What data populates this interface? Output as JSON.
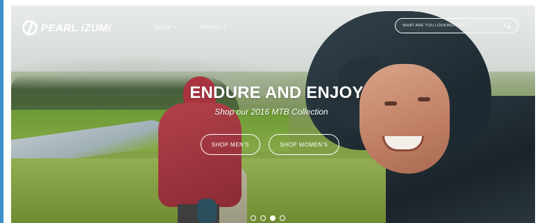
{
  "brand": {
    "name": "PEARL iZUMi",
    "logo_icon": "pearl-izumi-logo-mark"
  },
  "nav": {
    "items": [
      {
        "label": "SHOP",
        "icon": "chevron-down-icon"
      },
      {
        "label": "BRAND",
        "icon": "chevron-down-icon"
      }
    ]
  },
  "search": {
    "placeholder": "WHAT ARE YOU LOOKING FOR?",
    "icon": "search-icon"
  },
  "hero": {
    "headline": "ENDURE AND ENJOY",
    "subhead": "Shop our 2016 MTB Collection",
    "buttons": [
      {
        "label": "SHOP MEN'S"
      },
      {
        "label": "SHOP WOMEN'S"
      }
    ],
    "carousel": {
      "total": 4,
      "active_index": 2
    }
  },
  "colors": {
    "accent_border": "#3b8fcc",
    "text": "#ffffff"
  },
  "icons": {
    "caret": "▾"
  }
}
